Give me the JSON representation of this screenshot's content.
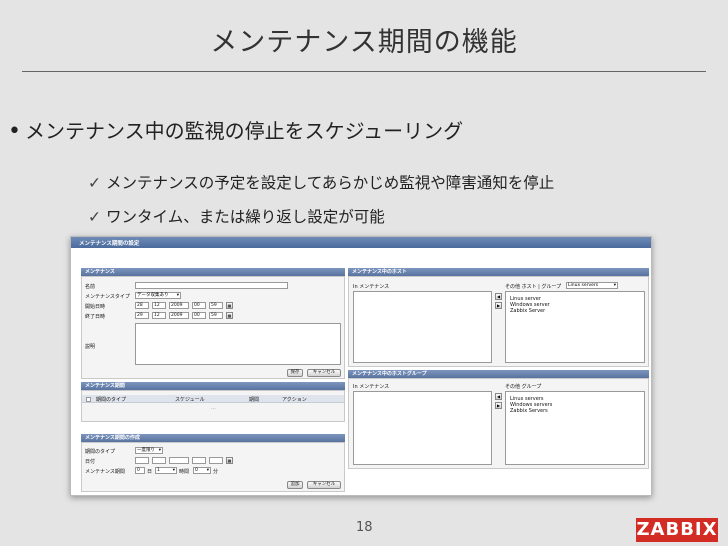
{
  "slide": {
    "title": "メンテナンス期間の機能",
    "bullet": "メンテナンス中の監視の停止をスケジューリング",
    "subs": [
      "メンテナンスの予定を設定してあらかじめ監視や障害通知を停止",
      "ワンタイム、または繰り返し設定が可能"
    ],
    "page_number": "18",
    "logo_text": "ZABBIX"
  },
  "screenshot": {
    "window_title": "メンテナンス期間の設定",
    "maintenance": {
      "header": "メンテナンス",
      "name_label": "名前",
      "name_value": "",
      "type_label": "メンテナンスタイプ",
      "type_value": "データ収集あり",
      "start_label": "開始日時",
      "start_fields": [
        "28",
        "12",
        "2009",
        "00",
        "59"
      ],
      "end_label": "終了日時",
      "end_fields": [
        "29",
        "12",
        "2009",
        "00",
        "59"
      ],
      "desc_label": "説明",
      "save": "保存",
      "cancel": "キャンセル"
    },
    "hosts": {
      "header": "メンテナンス中のホスト",
      "in_label": "In メンテナンス",
      "other_label": "その他 ホスト | グループ",
      "group_value": "Linux servers",
      "items": [
        "Linux server",
        "Windows server",
        "Zabbix Server"
      ]
    },
    "groups": {
      "header": "メンテナンス中のホストグループ",
      "in_label": "In メンテナンス",
      "other_label": "その他 グループ",
      "items": [
        "Linux servers",
        "Windows servers",
        "Zabbix Servers"
      ]
    },
    "periods": {
      "header": "メンテナンス期間",
      "columns": [
        "期間のタイプ",
        "スケジュール",
        "期間",
        "アクション"
      ],
      "empty": "..."
    },
    "period_create": {
      "header": "メンテナンス期間の作成",
      "type_label": "期間のタイプ",
      "type_value": "一度限り",
      "date_label": "日付",
      "date_fields": [
        "",
        "",
        "",
        "",
        ""
      ],
      "period_label": "メンテナンス期間",
      "period_days": "0",
      "period_days_unit": "日",
      "period_hours": "1",
      "period_hours_unit": "時間",
      "period_minutes": "0",
      "period_minutes_unit": "分",
      "add": "追加",
      "cancel": "キャンセル"
    }
  }
}
